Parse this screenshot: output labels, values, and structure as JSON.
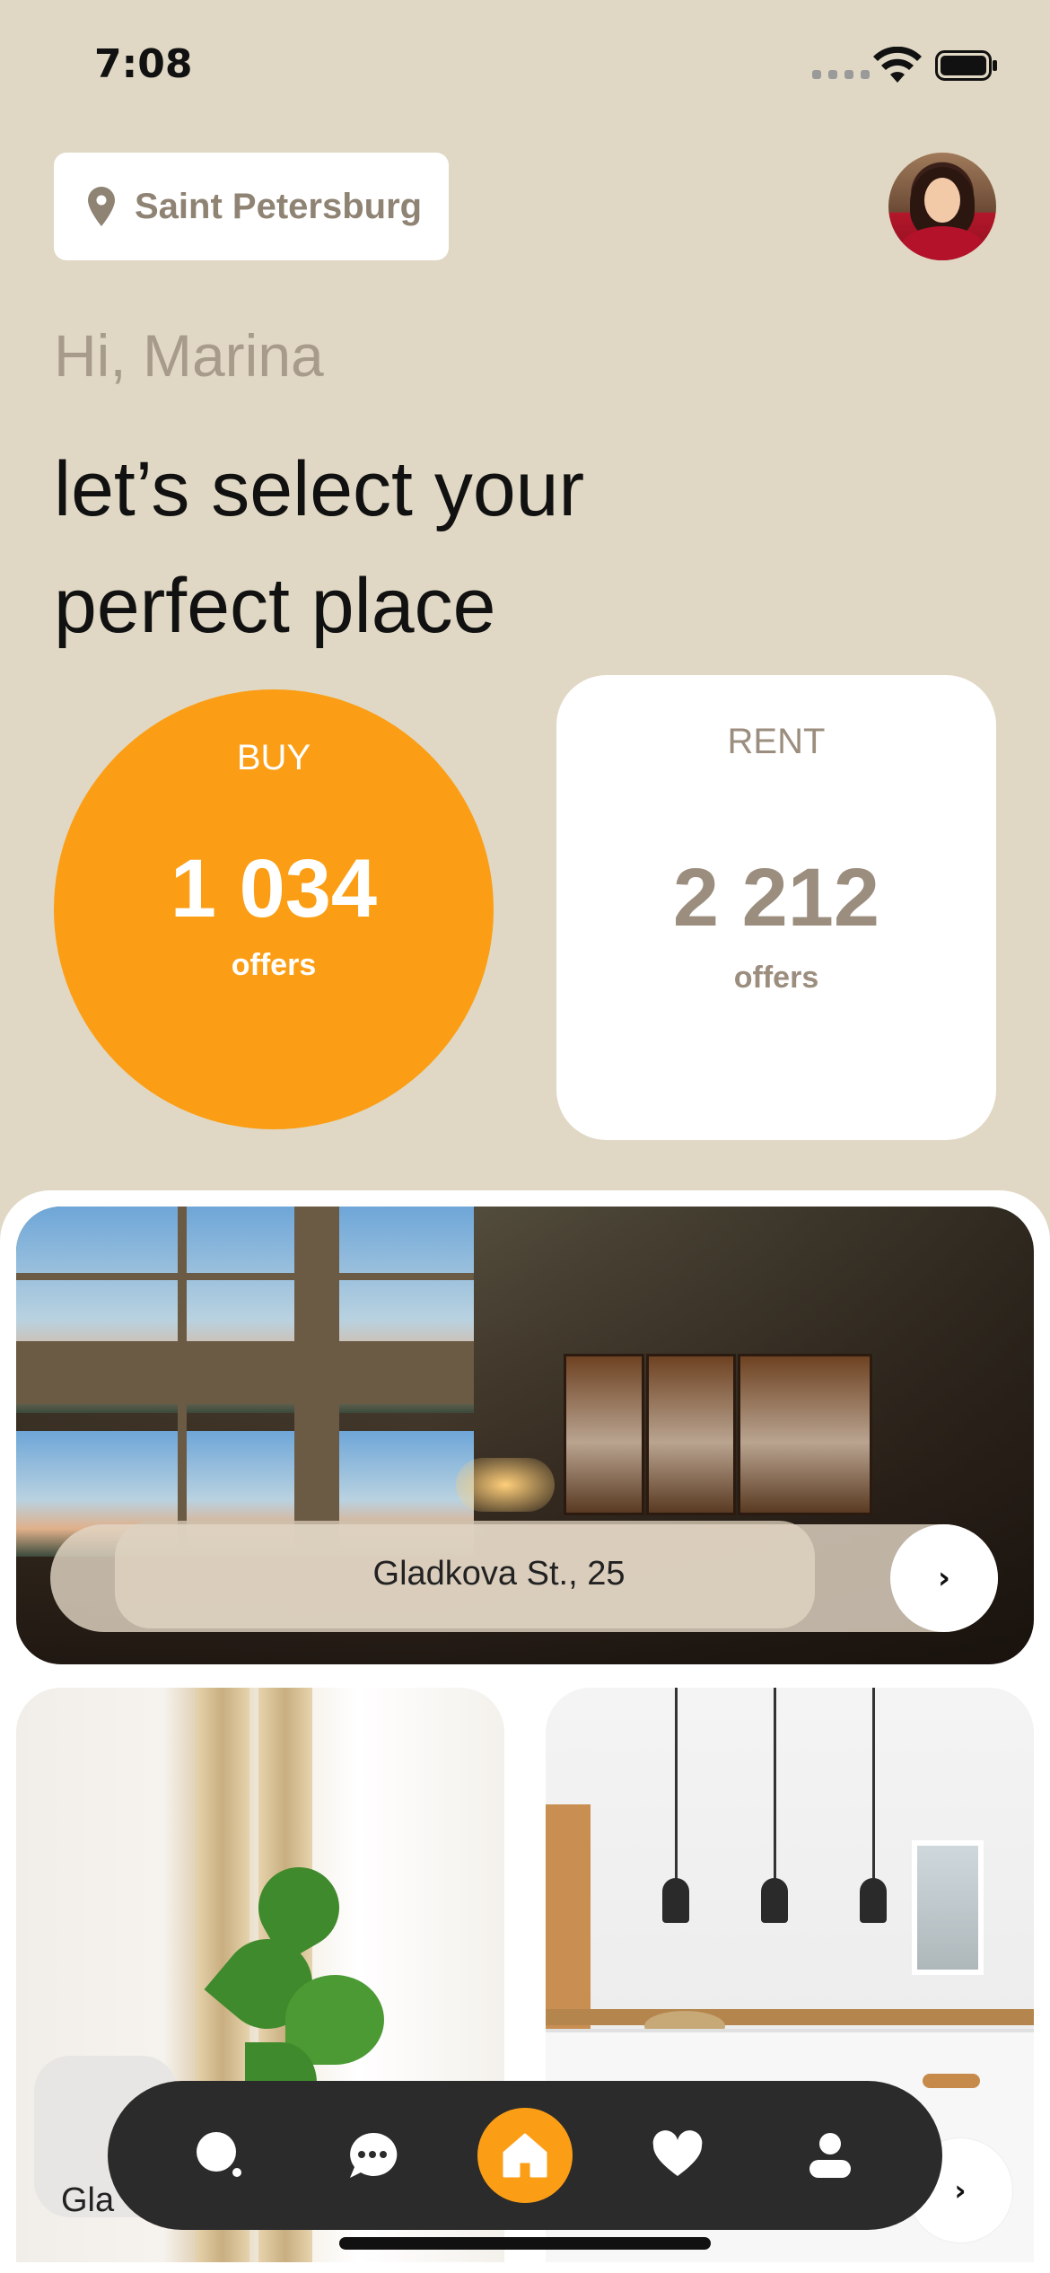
{
  "status_bar": {
    "time": "7:08",
    "icons": [
      "signal-dots-icon",
      "wifi-icon",
      "battery-icon"
    ]
  },
  "header": {
    "location": "Saint Petersburg",
    "location_icon": "map-pin-icon",
    "avatar": "user-avatar"
  },
  "greeting": {
    "hi": "Hi, Marina",
    "headline": "let’s select your perfect place"
  },
  "stats": {
    "buy": {
      "label": "BUY",
      "count": "1 034",
      "unit": "offers",
      "color": "#fb9e15"
    },
    "rent": {
      "label": "RENT",
      "count": "2 212",
      "unit": "offers"
    }
  },
  "listings": [
    {
      "address": "Gladkova St., 25",
      "arrow": "›"
    },
    {
      "address_visible": "Gla"
    },
    {
      "arrow": "›"
    }
  ],
  "nav": {
    "items": [
      {
        "icon": "search-icon"
      },
      {
        "icon": "chat-icon"
      },
      {
        "icon": "home-icon",
        "active": true
      },
      {
        "icon": "heart-icon"
      },
      {
        "icon": "profile-icon"
      }
    ],
    "active_color": "#fb9e15",
    "bar_color": "#2b2b2b"
  },
  "colors": {
    "background": "#e0d8c4",
    "accent": "#fb9e15"
  }
}
